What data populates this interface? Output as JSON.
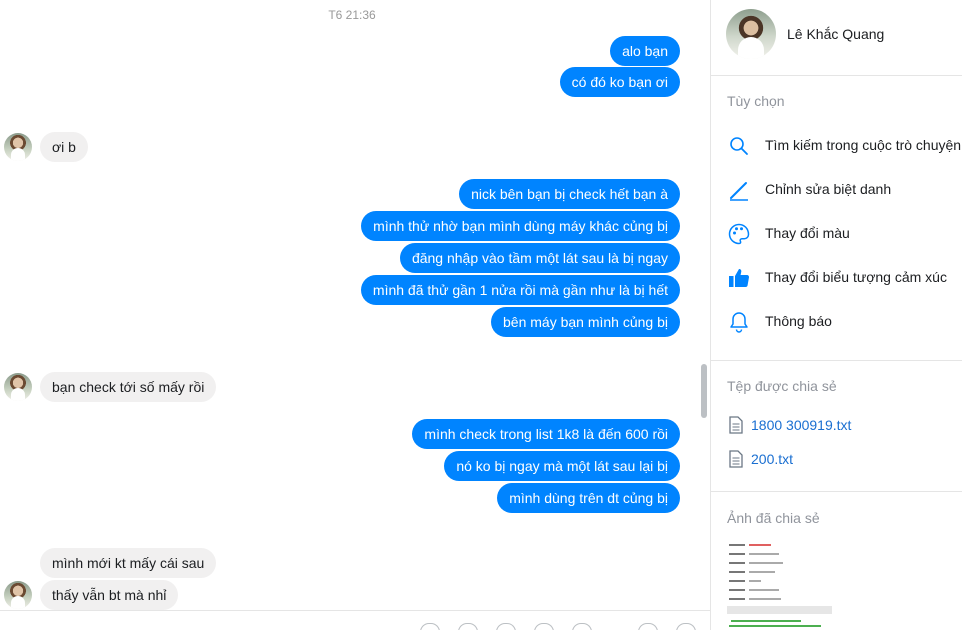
{
  "chat": {
    "timestamp": "T6 21:36",
    "messages": [
      {
        "dir": "out",
        "text": "alo bạn"
      },
      {
        "dir": "out",
        "text": "có đó ko bạn ơi"
      },
      {
        "dir": "in",
        "text": "ơi b"
      },
      {
        "dir": "out",
        "text": "nick bên bạn bị check hết bạn à"
      },
      {
        "dir": "out",
        "text": "mình thử nhờ bạn mình dùng máy khác củng bị"
      },
      {
        "dir": "out",
        "text": "đăng nhập vào tầm một lát sau là bị ngay"
      },
      {
        "dir": "out",
        "text": "mình đã thử gần 1 nửa rồi mà gần như là bị hết"
      },
      {
        "dir": "out",
        "text": "bên máy bạn mình củng bị"
      },
      {
        "dir": "in",
        "text": "bạn check tới số mấy rồi"
      },
      {
        "dir": "out",
        "text": "mình check trong list 1k8 là đến 600 rồi"
      },
      {
        "dir": "out",
        "text": "nó ko bị ngay mà một lát sau lại bị"
      },
      {
        "dir": "out",
        "text": "mình dùng trên dt củng bị"
      },
      {
        "dir": "in",
        "text": "mình mới kt mấy cái sau"
      },
      {
        "dir": "in",
        "text": "thấy vẫn bt mà nhỉ"
      }
    ]
  },
  "panel": {
    "contact_name": "Lê Khắc Quang",
    "options_title": "Tùy chọn",
    "options": [
      {
        "icon": "search-icon",
        "label": "Tìm kiếm trong cuộc trò chuyện"
      },
      {
        "icon": "pencil-icon",
        "label": "Chỉnh sửa biệt danh"
      },
      {
        "icon": "palette-icon",
        "label": "Thay đổi màu"
      },
      {
        "icon": "thumbs-up-icon",
        "label": "Thay đổi biểu tượng cảm xúc"
      },
      {
        "icon": "bell-icon",
        "label": "Thông báo"
      }
    ],
    "files_title": "Tệp được chia sẻ",
    "files": [
      {
        "icon": "file-icon",
        "name": "1800 300919.txt"
      },
      {
        "icon": "file-icon",
        "name": "200.txt"
      }
    ],
    "photos_title": "Ảnh đã chia sẻ"
  },
  "colors": {
    "outgoing_bubble": "#0084ff",
    "incoming_bubble": "#f1f0f0",
    "link": "#1a6fd1",
    "icon_accent": "#0084ff"
  }
}
